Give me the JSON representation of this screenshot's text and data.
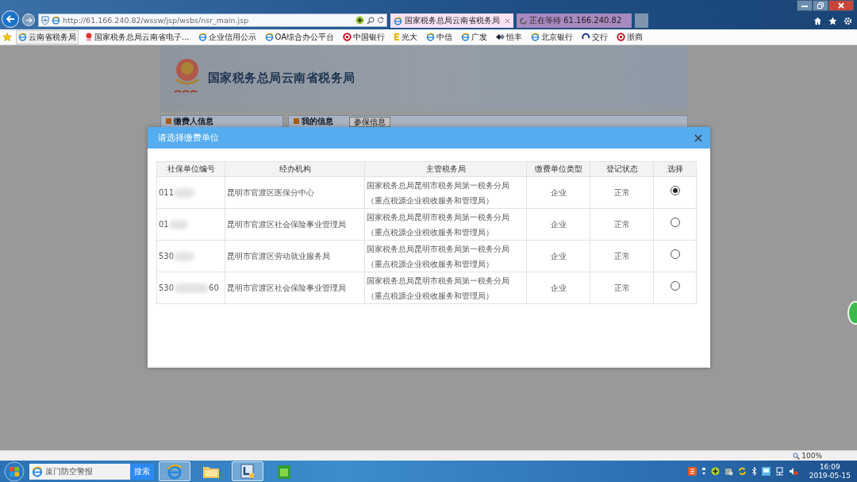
{
  "browser": {
    "address": "http://61.166.240.82/wssw/jsp/wsbs/nsr_main.jsp",
    "tabs": [
      {
        "label": "国家税务总局云南省税务局",
        "selected": true,
        "kind": "page"
      },
      {
        "label": "正在等待 61.166.240.82",
        "selected": false,
        "kind": "loading"
      }
    ],
    "favorites": [
      {
        "label": "云南省税务局",
        "kind": "ie",
        "selected": true
      },
      {
        "label": "国家税务总局云南省电子...",
        "kind": "emblem",
        "selected": false
      },
      {
        "label": "企业信用公示",
        "kind": "ie",
        "selected": false
      },
      {
        "label": "OA综合办公平台",
        "kind": "ie",
        "selected": false
      },
      {
        "label": "中国银行",
        "kind": "ring",
        "selected": false
      },
      {
        "label": "光大",
        "kind": "letter",
        "selected": false
      },
      {
        "label": "中信",
        "kind": "ie",
        "selected": false
      },
      {
        "label": "广发",
        "kind": "ie",
        "selected": false
      },
      {
        "label": "恒丰",
        "kind": "diamond",
        "selected": false
      },
      {
        "label": "北京银行",
        "kind": "ie",
        "selected": false
      },
      {
        "label": "交行",
        "kind": "swirl",
        "selected": false
      },
      {
        "label": "浙商",
        "kind": "ring",
        "selected": false
      }
    ]
  },
  "page": {
    "site_title": "国家税务总局云南省税务局",
    "panels": [
      "缴费人信息",
      "我的信息"
    ],
    "panel_button": "参保信息"
  },
  "dialog": {
    "title": "请选择缴费单位",
    "columns": [
      "社保单位编号",
      "经办机构",
      "主管税务局",
      "缴费单位类型",
      "登记状态",
      "选择"
    ],
    "rows": [
      {
        "id": "011",
        "agency": "昆明市官渡区医保分中心",
        "bureau": [
          "国家税务总局昆明市税务局第一税务分局",
          "（重点税源企业税收服务和管理局）"
        ],
        "type": "企业",
        "status": "正常",
        "selected": true
      },
      {
        "id": "01",
        "agency": "昆明市官渡区社会保险事业管理局",
        "bureau": [
          "国家税务总局昆明市税务局第一税务分局",
          "（重点税源企业税收服务和管理局）"
        ],
        "type": "企业",
        "status": "正常",
        "selected": false
      },
      {
        "id": "530",
        "agency": "昆明市官渡区劳动就业服务局",
        "bureau": [
          "国家税务总局昆明市税务局第一税务分局",
          "（重点税源企业税收服务和管理局）"
        ],
        "type": "企业",
        "status": "正常",
        "selected": false
      },
      {
        "id": "530",
        "id_end": "60",
        "agency": "昆明市官渡区社会保险事业管理局",
        "bureau": [
          "国家税务总局昆明市税务局第一税务分局",
          "（重点税源企业税收服务和管理局）"
        ],
        "type": "企业",
        "status": "正常",
        "selected": false
      }
    ]
  },
  "status_bar": {
    "zoom": "100%"
  },
  "taskbar": {
    "search_value": "厦门防空警报",
    "search_button": "搜索",
    "time": "16:09",
    "date": "2019-05-15"
  }
}
